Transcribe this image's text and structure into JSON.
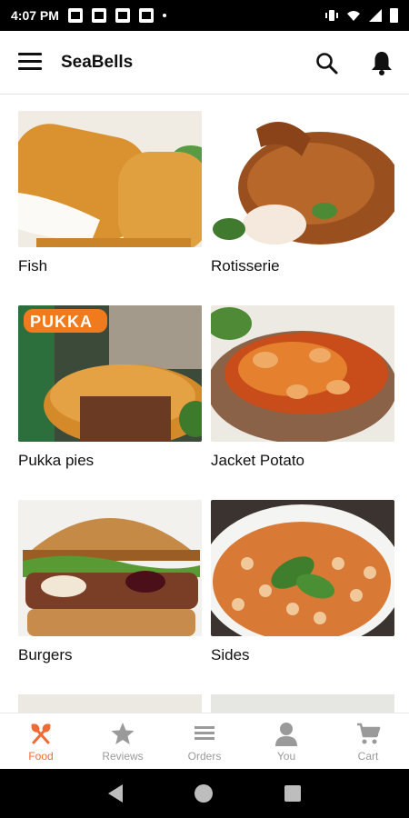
{
  "status_bar": {
    "time": "4:07 PM"
  },
  "header": {
    "title": "SeaBells"
  },
  "categories": [
    {
      "label": "Fish"
    },
    {
      "label": "Rotisserie"
    },
    {
      "label": "Pukka pies",
      "badge": "PUKKA"
    },
    {
      "label": "Jacket Potato"
    },
    {
      "label": "Burgers"
    },
    {
      "label": "Sides"
    }
  ],
  "bottom_nav": [
    {
      "label": "Food",
      "icon": "fork-knife-icon",
      "active": true
    },
    {
      "label": "Reviews",
      "icon": "star-icon"
    },
    {
      "label": "Orders",
      "icon": "list-icon"
    },
    {
      "label": "You",
      "icon": "person-icon"
    },
    {
      "label": "Cart",
      "icon": "cart-icon"
    }
  ],
  "colors": {
    "accent": "#f06a35",
    "inactive": "#9a9a9a"
  }
}
